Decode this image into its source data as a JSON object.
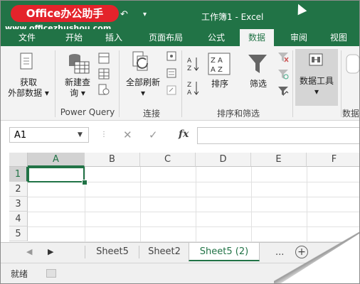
{
  "brand": {
    "logo_text": "Office办公助手",
    "url": "www.officezhushou.com"
  },
  "window": {
    "title": "工作簿1 - Excel"
  },
  "tabs": [
    "文件",
    "开始",
    "插入",
    "页面布局",
    "公式",
    "数据",
    "审阅",
    "视图"
  ],
  "active_tab": "数据",
  "ribbon": {
    "get_external": {
      "line1": "获取",
      "line2": "外部数据 ▾"
    },
    "new_query": {
      "line1": "新建查",
      "line2": "询 ▾"
    },
    "refresh_all": {
      "line1": "全部刷新",
      "line2": "▾"
    },
    "sort_az": "排序",
    "filter": "筛选",
    "data_tools": {
      "line1": "数据工具",
      "line2": "▾"
    },
    "groups": {
      "power_query": "Power Query",
      "connections": "连接",
      "sort_filter": "排序和筛选",
      "data_cut": "数据"
    }
  },
  "formula_bar": {
    "name_box": "A1",
    "fx": "fx",
    "formula": ""
  },
  "columns": [
    "A",
    "B",
    "C",
    "D",
    "E",
    "F"
  ],
  "rows": [
    "1",
    "2",
    "3",
    "4",
    "5"
  ],
  "selected_cell": "A1",
  "sheets": [
    "Sheet5",
    "Sheet2",
    "Sheet5 (2)"
  ],
  "active_sheet": "Sheet5 (2)",
  "sheet_overflow": "...",
  "add_sheet": "+",
  "status": {
    "text": "就绪"
  },
  "colors": {
    "accent": "#217346",
    "brand_red": "#e4232b"
  }
}
